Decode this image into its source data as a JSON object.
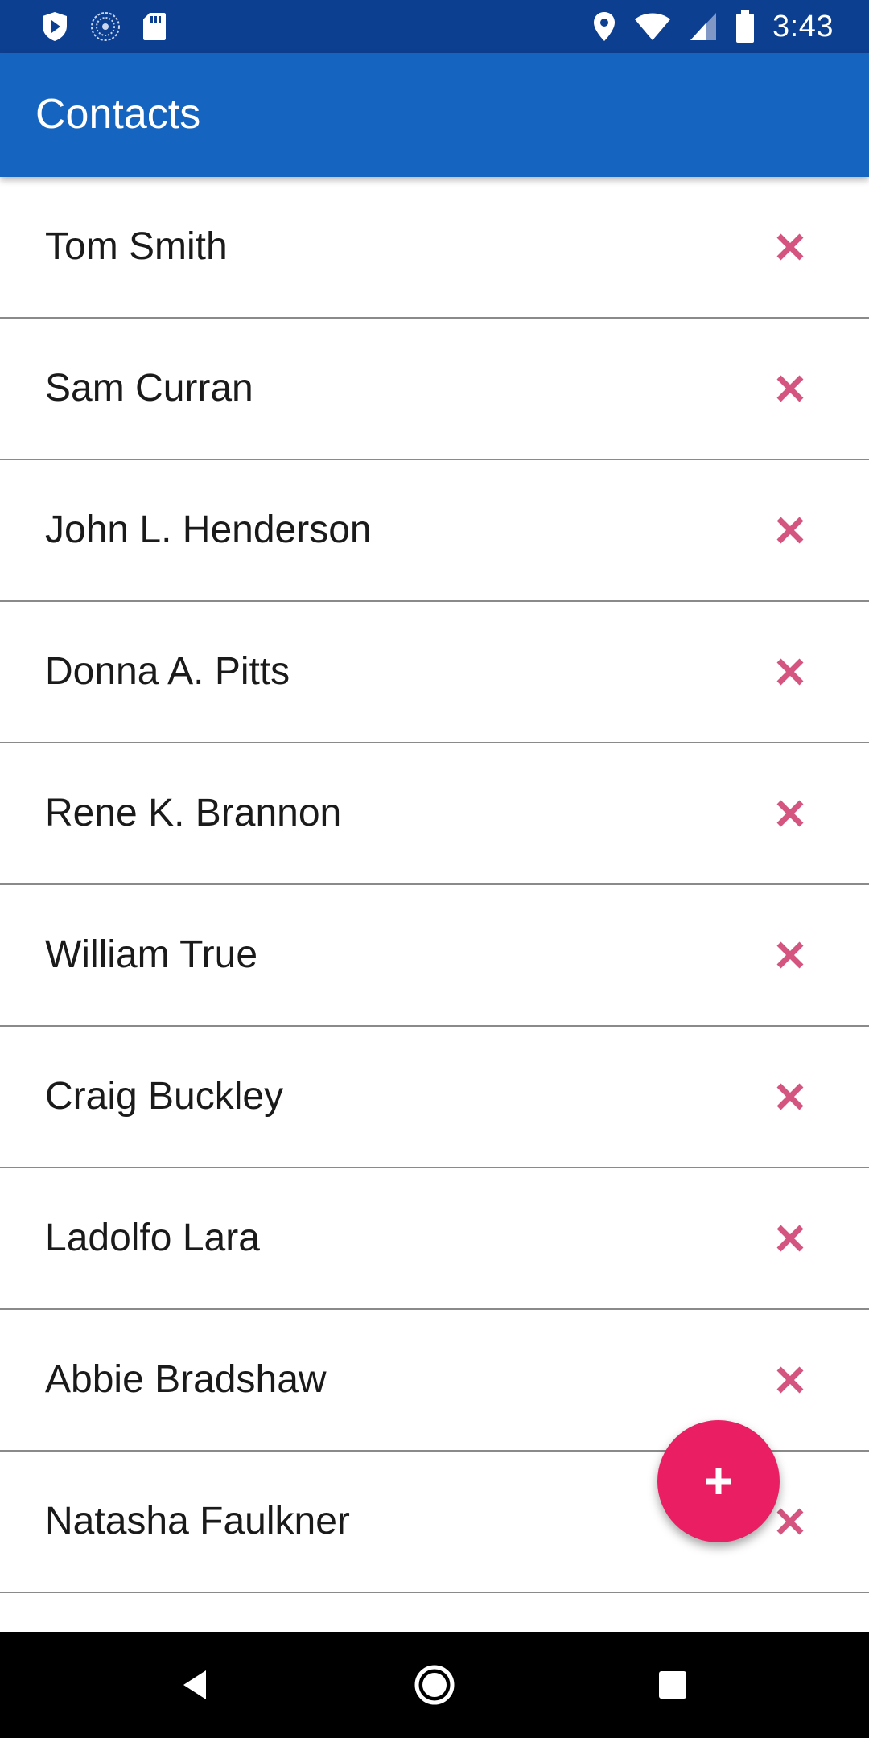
{
  "status_bar": {
    "time": "3:43",
    "left_icons": [
      "shield-play-icon",
      "sync-icon",
      "sd-card-icon"
    ],
    "right_icons": [
      "location-icon",
      "wifi-icon",
      "signal-icon",
      "battery-icon"
    ]
  },
  "app_bar": {
    "title": "Contacts"
  },
  "contacts": [
    {
      "name": "Tom Smith"
    },
    {
      "name": "Sam Curran"
    },
    {
      "name": "John L. Henderson"
    },
    {
      "name": "Donna A. Pitts"
    },
    {
      "name": "Rene K. Brannon"
    },
    {
      "name": "William True"
    },
    {
      "name": "Craig Buckley"
    },
    {
      "name": "Ladolfo Lara"
    },
    {
      "name": "Abbie Bradshaw"
    },
    {
      "name": "Natasha Faulkner"
    },
    {
      "name": ""
    }
  ],
  "fab": {
    "icon": "plus-icon",
    "color": "#e91e63"
  },
  "colors": {
    "status_bar": "#0d3f91",
    "app_bar": "#1565c0",
    "delete_icon": "#d4557f"
  },
  "nav_bar": {
    "icons": [
      "back-icon",
      "home-icon",
      "recents-icon"
    ]
  }
}
